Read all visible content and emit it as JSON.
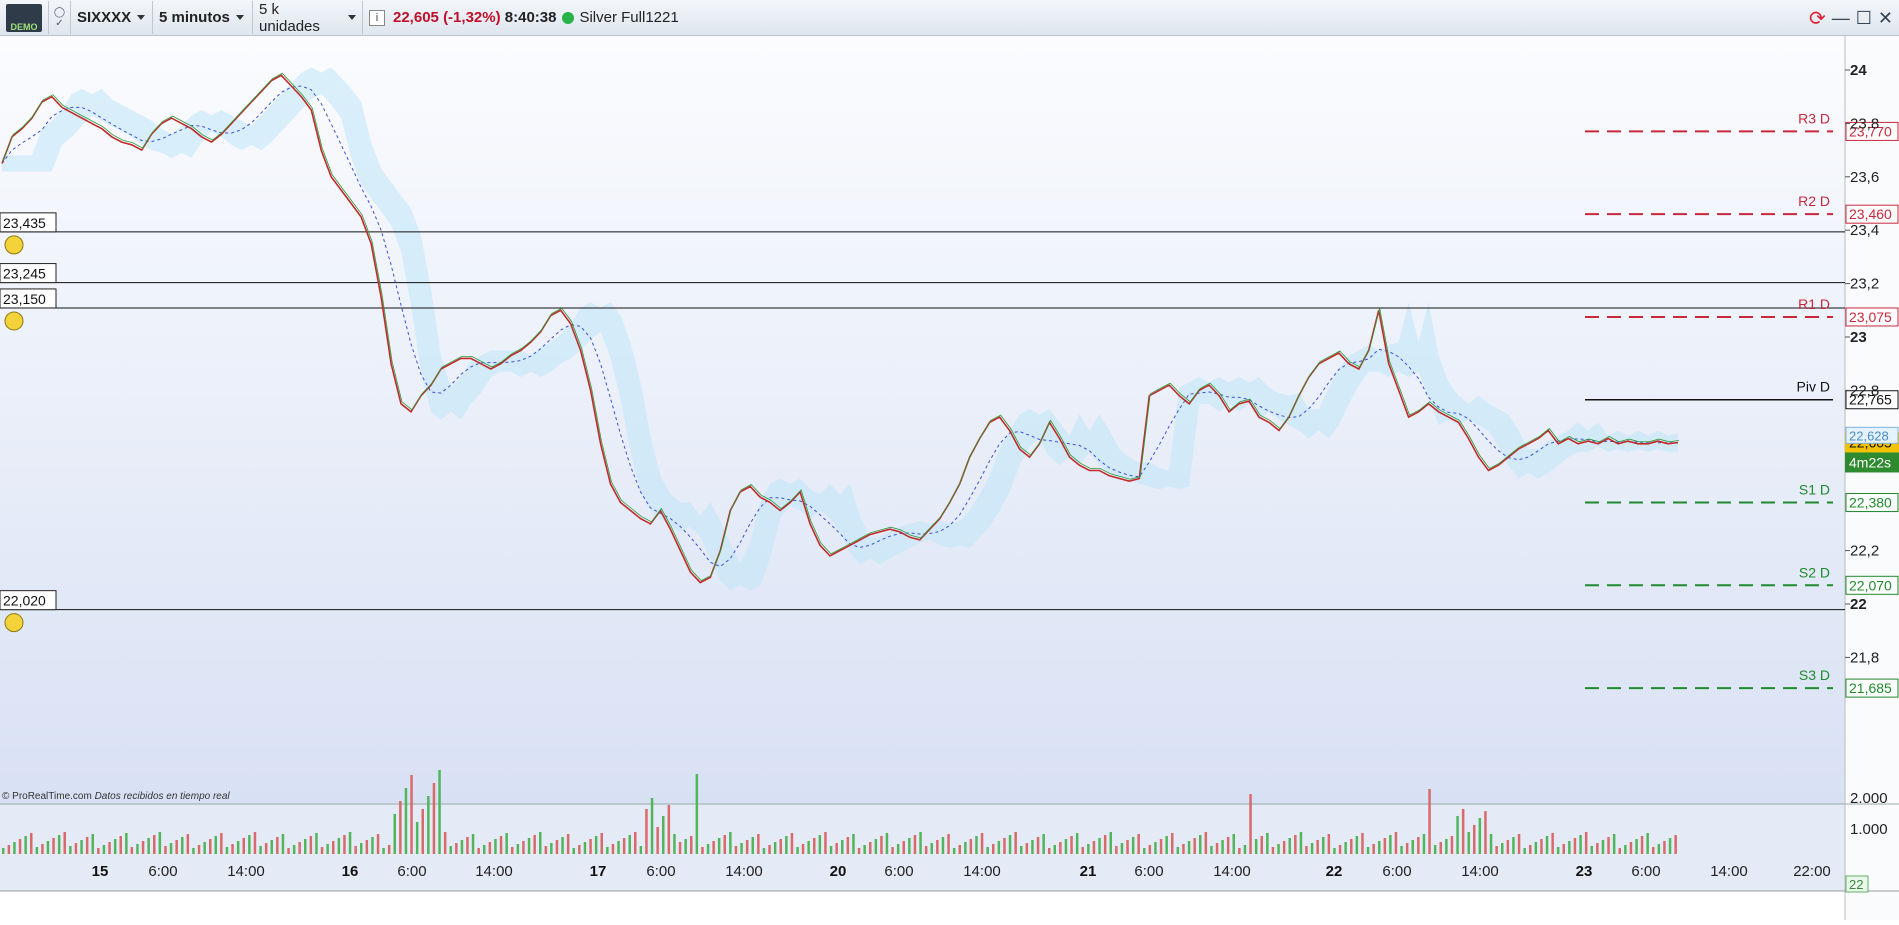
{
  "toolbar": {
    "demo_label": "DEMO",
    "symbol": "SIXXXX",
    "timeframe": "5 minutos",
    "units": "5 k unidades",
    "info_icon": "i",
    "price": "22,605",
    "change": "(-1,32%)",
    "time": "8:40:38",
    "source": "Silver Full1221"
  },
  "chart_data": {
    "type": "line",
    "x_day_labels": [
      "15",
      "16",
      "17",
      "20",
      "21",
      "22",
      "23"
    ],
    "x_time_labels": [
      "6:00",
      "14:00",
      "6:00",
      "14:00",
      "6:00",
      "14:00",
      "6:00",
      "14:00",
      "6:00",
      "14:00",
      "6:00",
      "14:00",
      "6:00",
      "14:00",
      "22:00"
    ],
    "y_ticks": [
      "24",
      "23,8",
      "23,6",
      "23,4",
      "23,2",
      "23",
      "22,8",
      "22,2",
      "22",
      "21,8"
    ],
    "ylim": [
      21.7,
      24.15
    ],
    "volume_ticks": [
      "2.000",
      "1.000"
    ],
    "pivot_levels": [
      {
        "name": "R3 D",
        "value": "23,770"
      },
      {
        "name": "R2 D",
        "value": "23,460"
      },
      {
        "name": "R1 D",
        "value": "23,075"
      },
      {
        "name": "Piv D",
        "value": "22,765"
      },
      {
        "name": "S1 D",
        "value": "22,380"
      },
      {
        "name": "S2 D",
        "value": "22,070"
      },
      {
        "name": "S3 D",
        "value": "21,685"
      }
    ],
    "alert_levels": [
      "23,435",
      "23,245",
      "23,150",
      "22,020"
    ],
    "last_price": "22,605",
    "countdown": "4m22s",
    "cloud_label": "22,628",
    "volume_badge": "22",
    "series": [
      {
        "name": "Price",
        "x": [
          0,
          1,
          2,
          3,
          4,
          5,
          6,
          7,
          8,
          9,
          10,
          11,
          12,
          13,
          14,
          15,
          16,
          17,
          18,
          19,
          20,
          21,
          22,
          23,
          24,
          25,
          26,
          27,
          28,
          29,
          30,
          31,
          32,
          33,
          34,
          35,
          36,
          37,
          38,
          39,
          40,
          41,
          42,
          43,
          44,
          45,
          46,
          47,
          48,
          49,
          50,
          51,
          52,
          53,
          54,
          55,
          56,
          57,
          58,
          59,
          60,
          61,
          62,
          63,
          64,
          65,
          66,
          67,
          68,
          69,
          70,
          71,
          72,
          73,
          74,
          75,
          76,
          77,
          78,
          79,
          80,
          81,
          82,
          83,
          84,
          85,
          86,
          87,
          88,
          89,
          90,
          91,
          92,
          93,
          94,
          95,
          96,
          97,
          98,
          99,
          100,
          101,
          102,
          103,
          104,
          105,
          106,
          107,
          108,
          109,
          110,
          111,
          112,
          113,
          114,
          115,
          116,
          117,
          118,
          119,
          120,
          121,
          122,
          123,
          124,
          125,
          126,
          127,
          128,
          129,
          130,
          131,
          132,
          133,
          134,
          135,
          136,
          137,
          138,
          139,
          140,
          141,
          142,
          143,
          144,
          145,
          146,
          147,
          148,
          149,
          150,
          151,
          152,
          153,
          154,
          155,
          156,
          157,
          158,
          159,
          160,
          161,
          162,
          163,
          164,
          165,
          166,
          167,
          168
        ],
        "y": [
          23.65,
          23.75,
          23.78,
          23.82,
          23.88,
          23.9,
          23.86,
          23.84,
          23.82,
          23.8,
          23.78,
          23.75,
          23.73,
          23.72,
          23.7,
          23.76,
          23.8,
          23.82,
          23.8,
          23.78,
          23.75,
          23.73,
          23.76,
          23.8,
          23.84,
          23.88,
          23.92,
          23.96,
          23.98,
          23.94,
          23.9,
          23.85,
          23.7,
          23.6,
          23.55,
          23.5,
          23.45,
          23.35,
          23.15,
          22.9,
          22.75,
          22.72,
          22.78,
          22.82,
          22.88,
          22.9,
          22.92,
          22.92,
          22.9,
          22.88,
          22.9,
          22.93,
          22.95,
          22.98,
          23.02,
          23.08,
          23.1,
          23.05,
          22.95,
          22.8,
          22.6,
          22.45,
          22.38,
          22.35,
          22.32,
          22.3,
          22.35,
          22.28,
          22.2,
          22.12,
          22.08,
          22.1,
          22.2,
          22.35,
          22.42,
          22.44,
          22.4,
          22.38,
          22.35,
          22.38,
          22.42,
          22.3,
          22.22,
          22.18,
          22.2,
          22.22,
          22.24,
          22.26,
          22.27,
          22.28,
          22.27,
          22.25,
          22.24,
          22.28,
          22.32,
          22.38,
          22.45,
          22.55,
          22.62,
          22.68,
          22.7,
          22.65,
          22.58,
          22.55,
          22.6,
          22.68,
          22.62,
          22.55,
          22.52,
          22.5,
          22.5,
          22.48,
          22.47,
          22.46,
          22.47,
          22.78,
          22.8,
          22.82,
          22.78,
          22.75,
          22.8,
          22.82,
          22.78,
          22.72,
          22.75,
          22.76,
          22.7,
          22.68,
          22.65,
          22.7,
          22.78,
          22.85,
          22.9,
          22.92,
          22.94,
          22.9,
          22.88,
          22.95,
          23.1,
          22.9,
          22.8,
          22.7,
          22.72,
          22.75,
          22.72,
          22.7,
          22.68,
          22.62,
          22.55,
          22.5,
          22.52,
          22.55,
          22.58,
          22.6,
          22.62,
          22.65,
          22.6,
          22.62,
          22.6,
          22.61,
          22.6,
          22.62,
          22.6,
          22.61,
          22.6,
          22.6,
          22.61,
          22.6,
          22.605
        ]
      }
    ]
  }
}
